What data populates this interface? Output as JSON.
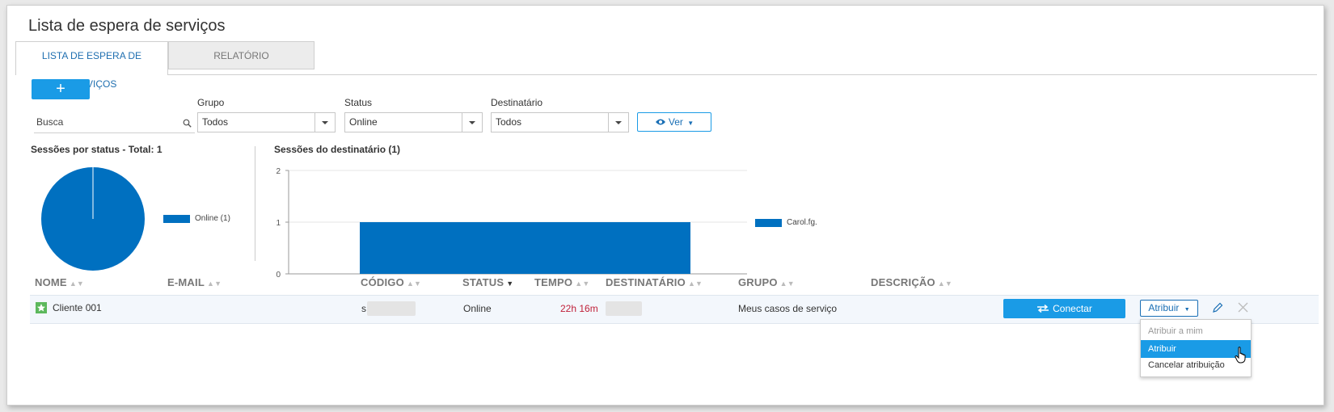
{
  "page": {
    "title": "Lista de espera de serviços"
  },
  "tabs": [
    {
      "label": "LISTA DE ESPERA DE SERVIÇOS",
      "active": true
    },
    {
      "label": "RELATÓRIO",
      "active": false
    }
  ],
  "toolbar": {
    "add_label": "+",
    "view_label": "Ver"
  },
  "search": {
    "placeholder": "Busca"
  },
  "filters": {
    "group": {
      "label": "Grupo",
      "value": "Todos"
    },
    "status": {
      "label": "Status",
      "value": "Online"
    },
    "recipient": {
      "label": "Destinatário",
      "value": "Todos"
    }
  },
  "pie": {
    "title": "Sessões por status - Total: 1",
    "legend": "Online (1)",
    "color": "#0070c0"
  },
  "bar": {
    "title": "Sessões do destinatário (1)",
    "legend": "Carol.fg.",
    "color": "#0070c0",
    "ticks": [
      "0",
      "1",
      "2"
    ]
  },
  "chart_data": [
    {
      "type": "pie",
      "title": "Sessões por status - Total: 1",
      "labels": [
        "Online"
      ],
      "values": [
        1
      ]
    },
    {
      "type": "bar",
      "title": "Sessões do destinatário (1)",
      "categories": [
        "Carol.fg."
      ],
      "values": [
        1
      ],
      "ylim": [
        0,
        2
      ]
    }
  ],
  "table": {
    "headers": {
      "name": "NOME",
      "email": "E-MAIL",
      "code": "CÓDIGO",
      "status": "STATUS",
      "time": "TEMPO",
      "recipient": "DESTINATÁRIO",
      "group": "GRUPO",
      "description": "DESCRIÇÃO"
    },
    "row": {
      "name": "Cliente 001",
      "code": "s",
      "status": "Online",
      "time": "22h 16m",
      "group": "Meus casos de serviço",
      "connect": "Conectar",
      "assign": "Atribuir"
    }
  },
  "assign_menu": [
    "Atribuir a mim",
    "Atribuir",
    "Cancelar atribuição"
  ],
  "colors": {
    "accent": "#1a9be6",
    "time": "#c0213a"
  }
}
